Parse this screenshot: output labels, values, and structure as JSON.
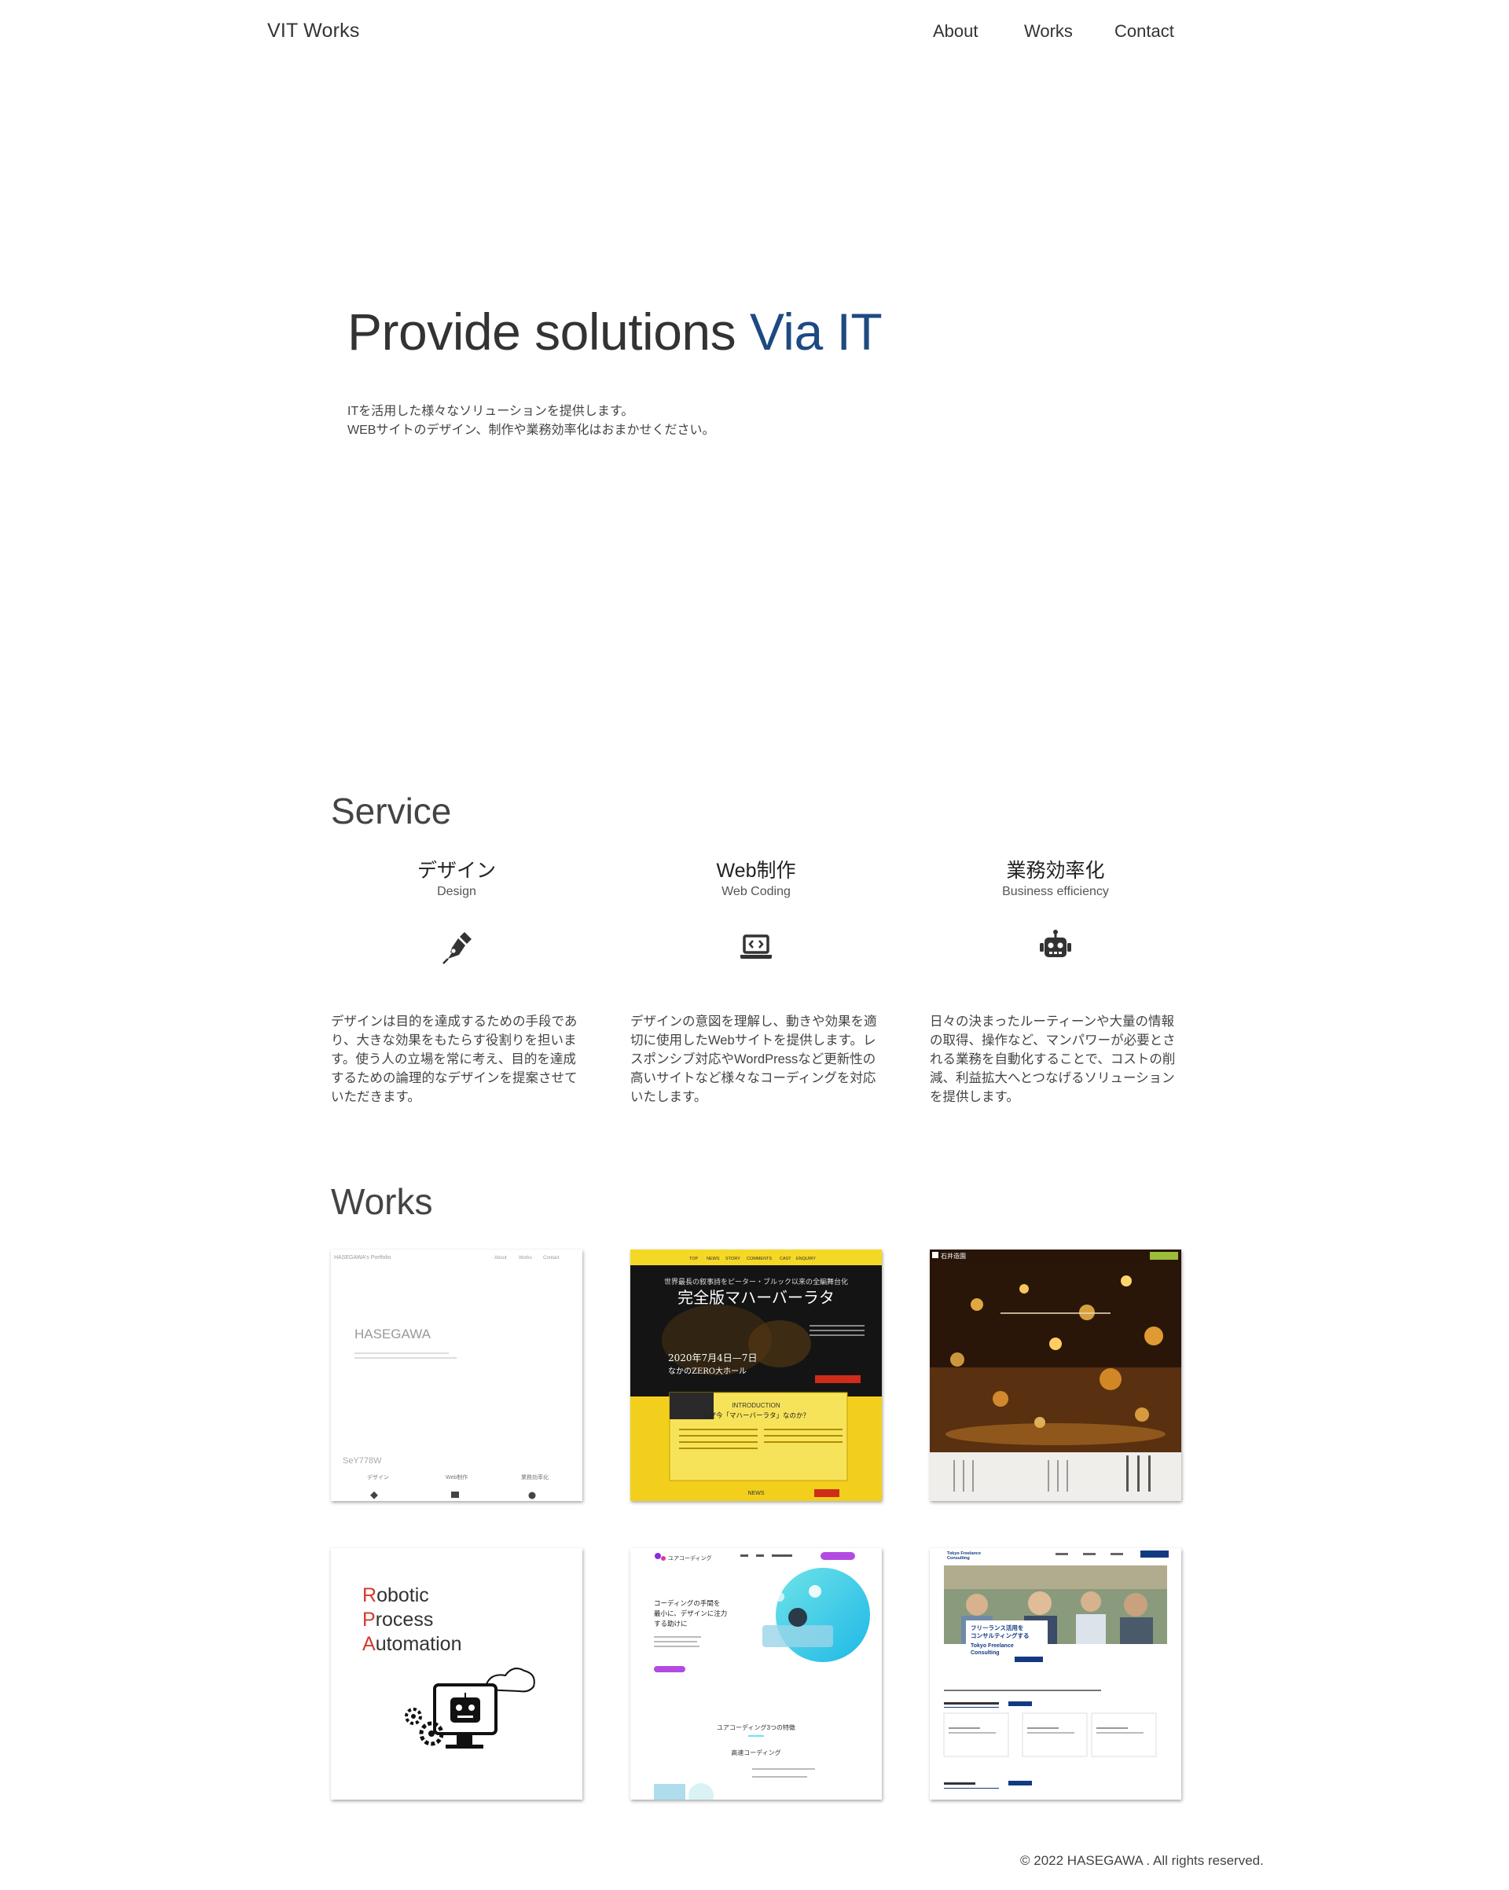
{
  "header": {
    "logo": "VIT Works",
    "nav": [
      "About",
      "Works",
      "Contact"
    ]
  },
  "hero": {
    "title_main": "Provide solutions ",
    "title_accent": "Via IT",
    "desc_line1": "ITを活用した様々なソリューションを提供します。",
    "desc_line2": "WEBサイトのデザイン、制作や業務効率化はおまかせください。"
  },
  "service": {
    "title": "Service",
    "items": [
      {
        "name": "デザイン",
        "sub": "Design",
        "icon": "pen-icon",
        "desc": "デザインは目的を達成するための手段であり、大きな効果をもたらす役割りを担います。使う人の立場を常に考え、目的を達成するための論理的なデザインを提案させていただきます。"
      },
      {
        "name": "Web制作",
        "sub": "Web Coding",
        "icon": "laptop-code-icon",
        "desc": "デザインの意図を理解し、動きや効果を適切に使用したWebサイトを提供します。レスポンシブ対応やWordPressなど更新性の高いサイトなど様々なコーディングを対応いたします。"
      },
      {
        "name": "業務効率化",
        "sub": "Business efficiency",
        "icon": "robot-icon",
        "desc": "日々の決まったルーティーンや大量の情報の取得、操作など、マンパワーが必要とされる業務を自動化することで、コストの削減、利益拡大へとつなげるソリューションを提供します。"
      }
    ]
  },
  "works": {
    "title": "Works",
    "thumb1": {
      "nav": [
        "About",
        "Works",
        "Contact"
      ],
      "site": "HASEGAWA's Portfolio",
      "logo": "HASEGAWA",
      "bottom": "SeY778W",
      "cols": [
        "デザイン",
        "Web制作",
        "業務効率化"
      ]
    },
    "thumb2": {
      "nav": [
        "TOP",
        "NEWS",
        "STORY",
        "COMMENTS",
        "CAST",
        "ENQUIRY"
      ],
      "tagline": "世界最長の叙事詩をピーター・ブルック以来の全編舞台化",
      "title": "完全版マハーバーラタ",
      "date": "2020年7月4日—7日",
      "venue": "なかのZERO大ホール",
      "intro": "INTRODUCTION",
      "question": "なぜ今「マハーバーラタ」なのか？",
      "news": "NEWS"
    },
    "thumb3": {
      "brand": "石井造園"
    },
    "thumb4": {
      "line1_first": "R",
      "line1_rest": "obotic",
      "line2_first": "P",
      "line2_rest": "rocess",
      "line3_first": "A",
      "line3_rest": "utomation"
    },
    "thumb5": {
      "brand": "ユアコーディング",
      "headline1": "コーディングの手間を",
      "headline2": "最小に、デザインに注力",
      "headline3": "する助けに",
      "section": "ユアコーディング3つの特徴",
      "feature": "高速コーディング"
    },
    "thumb6": {
      "brand1": "Tokyo Freelance",
      "brand2": "Consulting",
      "catch1": "フリーランス活用を",
      "catch2": "コンサルティングする",
      "name1": "Tokyo Freelance",
      "name2": "Consulting"
    }
  },
  "footer": {
    "copyright": "© 2022 HASEGAWA . All rights reserved."
  }
}
